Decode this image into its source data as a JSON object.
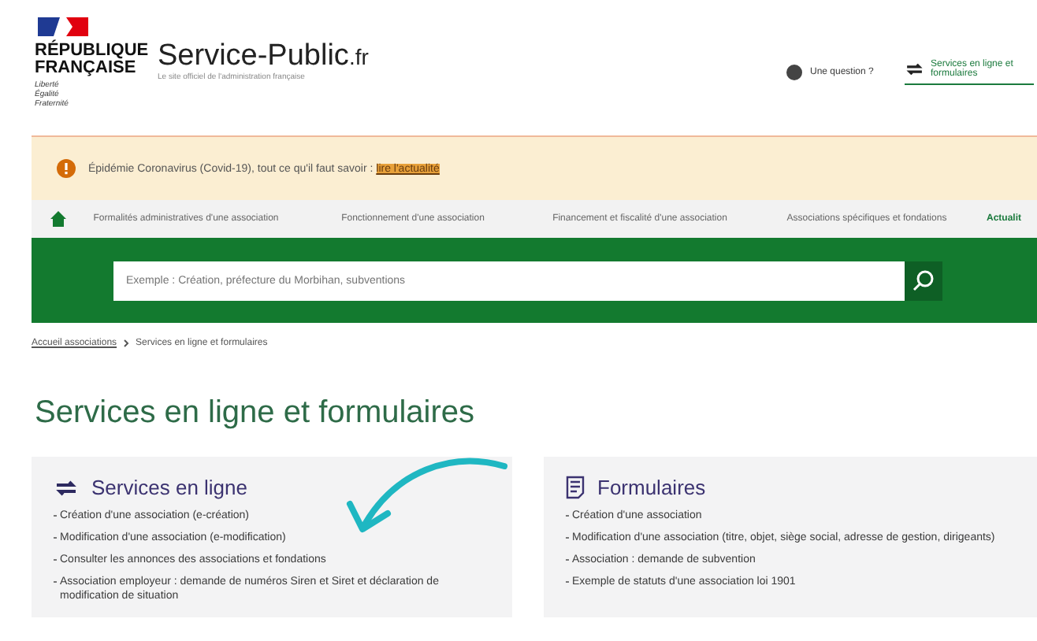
{
  "header": {
    "republic_name": "RÉPUBLIQUE\nFRANÇAISE",
    "motto": [
      "Liberté",
      "Égalité",
      "Fraternité"
    ],
    "site_name": "Service-Public",
    "site_suffix": ".fr",
    "tagline": "Le site officiel de l'administration française",
    "help_link": "Une question ?",
    "services_link": "Services en ligne et formulaires"
  },
  "alert": {
    "text": "Épidémie Coronavirus (Covid-19), tout ce qu'il faut savoir : ",
    "link": "lire l'actualité"
  },
  "nav": {
    "items": [
      {
        "label": "Formalités administratives d'une association",
        "selected": false
      },
      {
        "label": "Fonctionnement d'une association",
        "selected": false
      },
      {
        "label": "Financement et fiscalité d'une association",
        "selected": false
      },
      {
        "label": "Associations spécifiques et fondations",
        "selected": false
      },
      {
        "label": "Actualit",
        "selected": true
      }
    ]
  },
  "search": {
    "placeholder": "Exemple : Création, préfecture du Morbihan, subventions"
  },
  "breadcrumb": [
    "Accueil associations",
    "Services en ligne et formulaires"
  ],
  "page_title": "Services en ligne et formulaires",
  "cards": [
    {
      "kind": "services",
      "title": "Services en ligne",
      "items": [
        "Création d'une association (e-création)",
        "Modification d'une association (e-modification)",
        "Consulter les annonces des associations et fondations",
        "Association employeur : demande de numéros Siren et Siret et déclaration de modification de situation"
      ]
    },
    {
      "kind": "forms",
      "title": "Formulaires",
      "items": [
        "Création d'une association",
        "Modification d'une association (titre, objet, siège social, adresse de gestion, dirigeants)",
        "Association : demande de subvention",
        "Exemple de statuts d'une association loi 1901"
      ]
    }
  ]
}
